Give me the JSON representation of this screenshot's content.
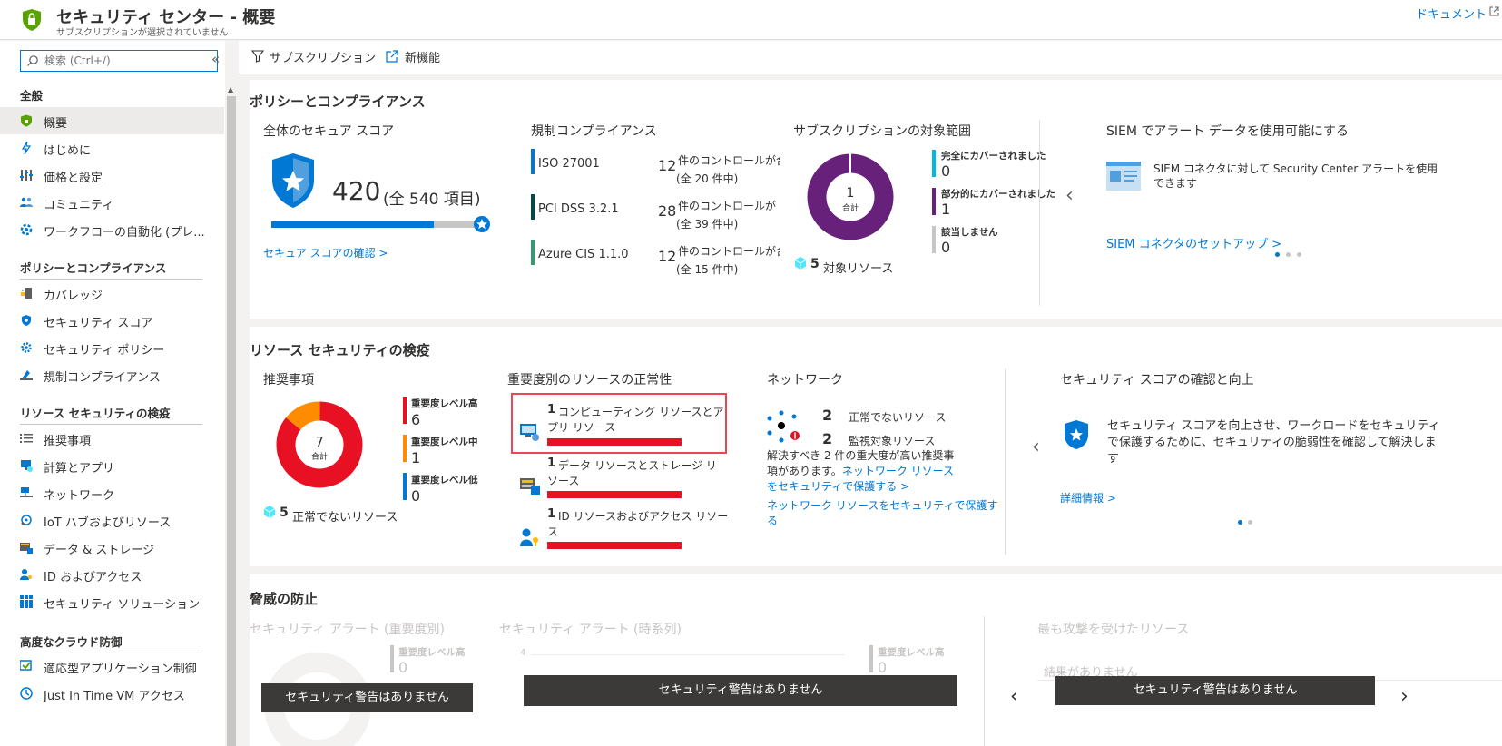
{
  "header": {
    "title": "セキュリティ センター - 概要",
    "subtitle": "サブスクリプションが選択されていません",
    "docs_link": "ドキュメント"
  },
  "sidebar": {
    "search_placeholder": "検索 (Ctrl+/)",
    "collapse_label": "«",
    "sections": [
      {
        "title": "全般",
        "items": [
          {
            "label": "概要",
            "icon": "shield-icon",
            "active": true
          },
          {
            "label": "はじめに",
            "icon": "lightning-icon"
          },
          {
            "label": "価格と設定",
            "icon": "settings-bars-icon"
          },
          {
            "label": "コミュニティ",
            "icon": "community-icon"
          },
          {
            "label": "ワークフローの自動化 (プレ...",
            "icon": "workflow-icon"
          }
        ]
      },
      {
        "title": "ポリシーとコンプライアンス",
        "items": [
          {
            "label": "カバレッジ",
            "icon": "coverage-icon"
          },
          {
            "label": "セキュリティ スコア",
            "icon": "shield-small-icon"
          },
          {
            "label": "セキュリティ ポリシー",
            "icon": "gear-icon"
          },
          {
            "label": "規制コンプライアンス",
            "icon": "compliance-icon"
          }
        ]
      },
      {
        "title": "リソース セキュリティの検疫",
        "items": [
          {
            "label": "推奨事項",
            "icon": "list-icon"
          },
          {
            "label": "計算とアプリ",
            "icon": "compute-icon"
          },
          {
            "label": "ネットワーク",
            "icon": "network-icon"
          },
          {
            "label": "IoT ハブおよびリソース",
            "icon": "iot-icon"
          },
          {
            "label": "データ & ストレージ",
            "icon": "storage-icon"
          },
          {
            "label": "ID およびアクセス",
            "icon": "identity-icon"
          },
          {
            "label": "セキュリティ ソリューション",
            "icon": "grid-icon"
          }
        ]
      },
      {
        "title": "高度なクラウド防御",
        "items": [
          {
            "label": "適応型アプリケーション制御",
            "icon": "app-control-icon"
          },
          {
            "label": "Just In Time VM アクセス",
            "icon": "clock-icon"
          }
        ]
      }
    ]
  },
  "toolbar": {
    "subscription_label": "サブスクリプション",
    "whats_new_label": "新機能"
  },
  "policy": {
    "title": "ポリシーとコンプライアンス",
    "secure_score": {
      "heading": "全体のセキュア スコア",
      "score": "420",
      "total": "(全 540 項目)",
      "progress": 0.78,
      "link": "セキュア スコアの確認 >"
    },
    "compliance": {
      "heading": "規制コンプライアンス",
      "items": [
        {
          "name": "ISO 27001",
          "count": "12",
          "text": "件のコントロールが合",
          "sub": "(全 20 件中)",
          "color": "#0078d4"
        },
        {
          "name": "PCI DSS 3.2.1",
          "count": "28",
          "text": "件のコントロールが",
          "sub": "(全 39 件中)",
          "color": "#004b50"
        },
        {
          "name": "Azure CIS 1.1.0",
          "count": "12",
          "text": "件のコントロールが合",
          "sub": "(全 15 件中)",
          "color": "#2e9e6e"
        }
      ]
    },
    "coverage": {
      "heading": "サブスクリプションの対象範囲",
      "donut_value": "1",
      "donut_label": "合計",
      "resources_count": "5",
      "resources_label": "対象リソース",
      "legend": [
        {
          "label": "完全にカバーされました",
          "value": "0",
          "color": "#00b7ea"
        },
        {
          "label": "部分的にカバーされました",
          "value": "1",
          "color": "#68217a"
        },
        {
          "label": "該当しません",
          "value": "0",
          "color": "#c8c6c4"
        }
      ]
    },
    "siem": {
      "heading": "SIEM でアラート データを使用可能にする",
      "text": "SIEM コネクタに対して Security Center アラートを使用",
      "text2": "できます",
      "link": "SIEM コネクタのセットアップ >"
    }
  },
  "resources": {
    "title": "リソース セキュリティの検疫",
    "recommendations": {
      "heading": "推奨事項",
      "total": "7",
      "total_label": "合計",
      "unhealthy_count": "5",
      "unhealthy_label": "正常でないリソース",
      "levels": [
        {
          "label": "重要度レベル高",
          "value": "6",
          "color": "#e81123"
        },
        {
          "label": "重要度レベル中",
          "value": "1",
          "color": "#ff8c00"
        },
        {
          "label": "重要度レベル低",
          "value": "0",
          "color": "#0078d4"
        }
      ]
    },
    "health": {
      "heading": "重要度別のリソースの正常性",
      "items": [
        {
          "count": "1",
          "line1": "コンピューティング リソースとア",
          "line2": "プリ リソース"
        },
        {
          "count": "1",
          "line1": "データ リソースとストレージ リ",
          "line2": "ソース"
        },
        {
          "count": "1",
          "line1": "ID リソースおよびアクセス リソー",
          "line2": "ス"
        }
      ]
    },
    "network": {
      "heading": "ネットワーク",
      "unhealthy_count": "2",
      "unhealthy_label": "正常でないリソース",
      "monitored_count": "2",
      "monitored_label": "監視対象リソース",
      "desc1": "解決すべき 2 件の重大度が高い推奨事",
      "desc2": "項があります。",
      "link1a": "ネットワーク リソース",
      "link1b": "をセキュリティで保護する >",
      "link2a": "ネットワーク リソースをセキュリティで保護す",
      "link2b": "る"
    },
    "score_improve": {
      "heading": "セキュリティ スコアの確認と向上",
      "text1": "セキュリティ スコアを向上させ、ワークロードをセキュリティ",
      "text2": "で保護するために、セキュリティの脆弱性を確認して解決しま",
      "text3": "す",
      "link": "詳細情報 >"
    }
  },
  "threat": {
    "title": "脅威の防止",
    "alerts_severity": {
      "heading": "セキュリティ アラート (重要度別)",
      "level_label": "重要度レベル高",
      "level_value": "0"
    },
    "alerts_time": {
      "heading": "セキュリティ アラート (時系列)",
      "axis_tick": "4",
      "level_label": "重要度レベル高",
      "level_value": "0"
    },
    "most_attacked": {
      "heading": "最も攻撃を受けたリソース",
      "no_results": "結果がありません"
    },
    "no_alerts": "セキュリティ警告はありません"
  }
}
